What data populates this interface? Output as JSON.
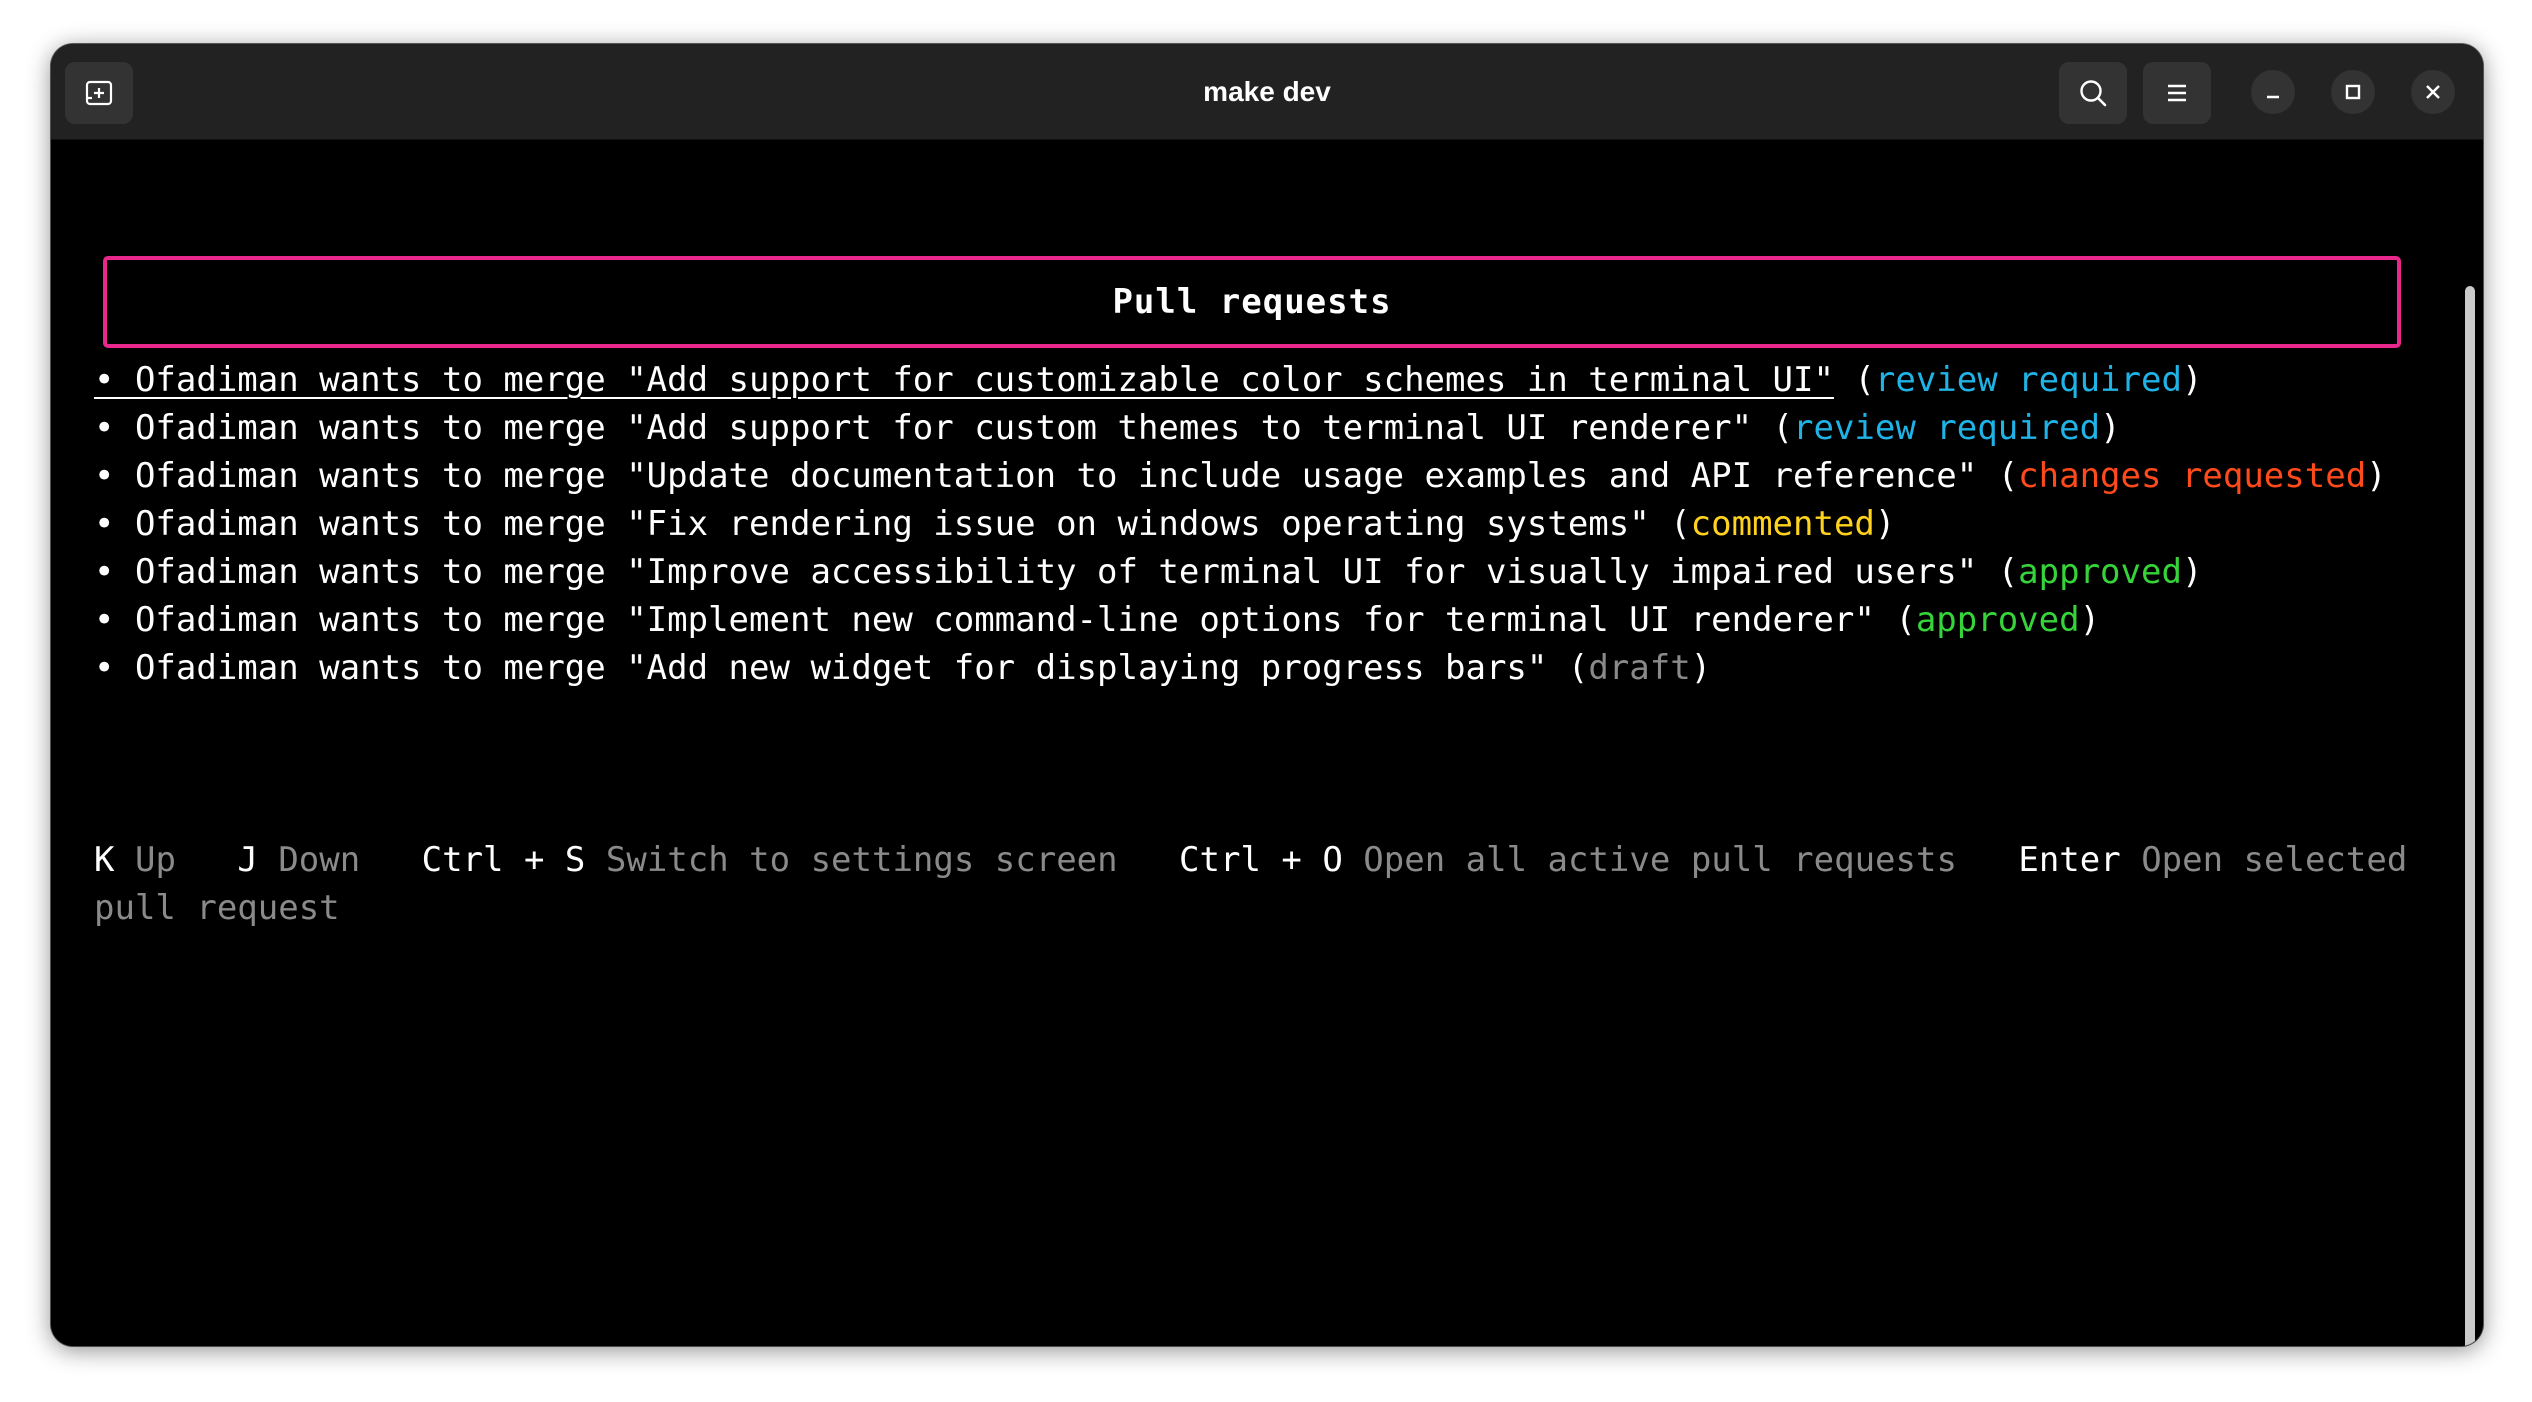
{
  "window": {
    "title": "make dev"
  },
  "colors": {
    "review required": "#1fb3e6",
    "changes requested": "#ff4a1c",
    "commented": "#ffd21f",
    "approved": "#36d43a",
    "draft": "#8a8a8a",
    "border": "#e9278c"
  },
  "header": {
    "title": "Pull requests"
  },
  "pull_requests": [
    {
      "text": "• Ofadiman wants to merge \"Add support for customizable color schemes in terminal UI\"",
      "status": "review required",
      "selected": true
    },
    {
      "text": "• Ofadiman wants to merge \"Add support for custom themes to terminal UI renderer\"",
      "status": "review required",
      "selected": false
    },
    {
      "text": "• Ofadiman wants to merge \"Update documentation to include usage examples and API reference\"",
      "status": "changes requested",
      "selected": false
    },
    {
      "text": "• Ofadiman wants to merge \"Fix rendering issue on windows operating systems\"",
      "status": "commented",
      "selected": false
    },
    {
      "text": "• Ofadiman wants to merge \"Improve accessibility of terminal UI for visually impaired users\"",
      "status": "approved",
      "selected": false
    },
    {
      "text": "• Ofadiman wants to merge \"Implement new command-line options for terminal UI renderer\"",
      "status": "approved",
      "selected": false
    },
    {
      "text": "• Ofadiman wants to merge \"Add new widget for displaying progress bars\"",
      "status": "draft",
      "selected": false
    }
  ],
  "shortcuts": [
    {
      "key": "K",
      "desc": "Up"
    },
    {
      "key": "J",
      "desc": "Down"
    },
    {
      "key": "Ctrl + S",
      "desc": "Switch to settings screen"
    },
    {
      "key": "Ctrl + O",
      "desc": "Open all active pull requests"
    },
    {
      "key": "Enter",
      "desc": "Open selected pull request"
    }
  ],
  "icons": {
    "new_tab": "new-tab-icon",
    "search": "search-icon",
    "menu": "hamburger-menu-icon",
    "minimize": "minimize-icon",
    "maximize": "maximize-icon",
    "close": "close-icon"
  }
}
